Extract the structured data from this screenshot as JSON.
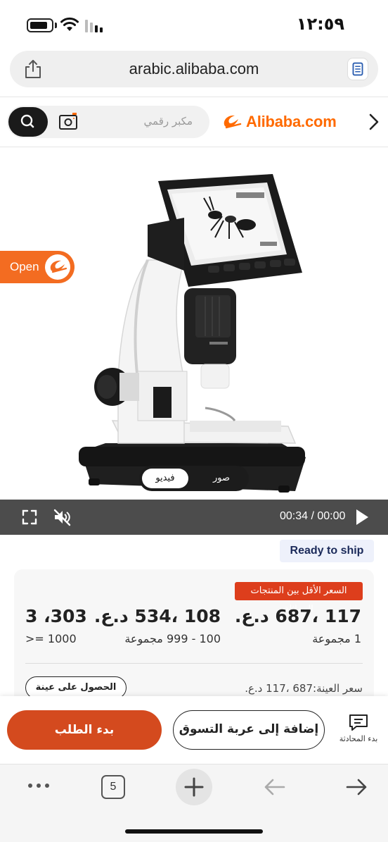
{
  "status_bar": {
    "time": "١٢:٥٩"
  },
  "url_bar": {
    "url": "arabic.alibaba.com"
  },
  "site_header": {
    "search_placeholder": "مكبر رقمي",
    "logo_text": "Alibaba.com",
    "brand_color": "#ff6a00"
  },
  "media": {
    "open_label": "Open",
    "tabs": {
      "video": "فيديو",
      "photos": "صور"
    },
    "player": {
      "time": "00:34 / 00:00"
    }
  },
  "badge": {
    "ready_to_ship": "Ready to ship"
  },
  "pricing": {
    "promo_label": "السعر الأقل بين المنتجات المماثلة",
    "tiers": [
      {
        "price": "117 ،687 د.ع.",
        "quantity": "1 مجموعة"
      },
      {
        "price": "108 ،534 د.ع.",
        "quantity": "100 - 999 مجموعة"
      },
      {
        "price": "3 ،303",
        "quantity": ">= 1000"
      }
    ],
    "sample_price": "سعر العينة:687 ،117 د.ع.",
    "sample_button": "الحصول على عينة"
  },
  "actions": {
    "order_button": "بدء الطلب",
    "cart_button": "إضافة إلى عربة التسوق",
    "chat_label": "بدء المحادثة",
    "accent_color": "#d44a1e"
  },
  "browser_toolbar": {
    "tab_count": "5"
  }
}
